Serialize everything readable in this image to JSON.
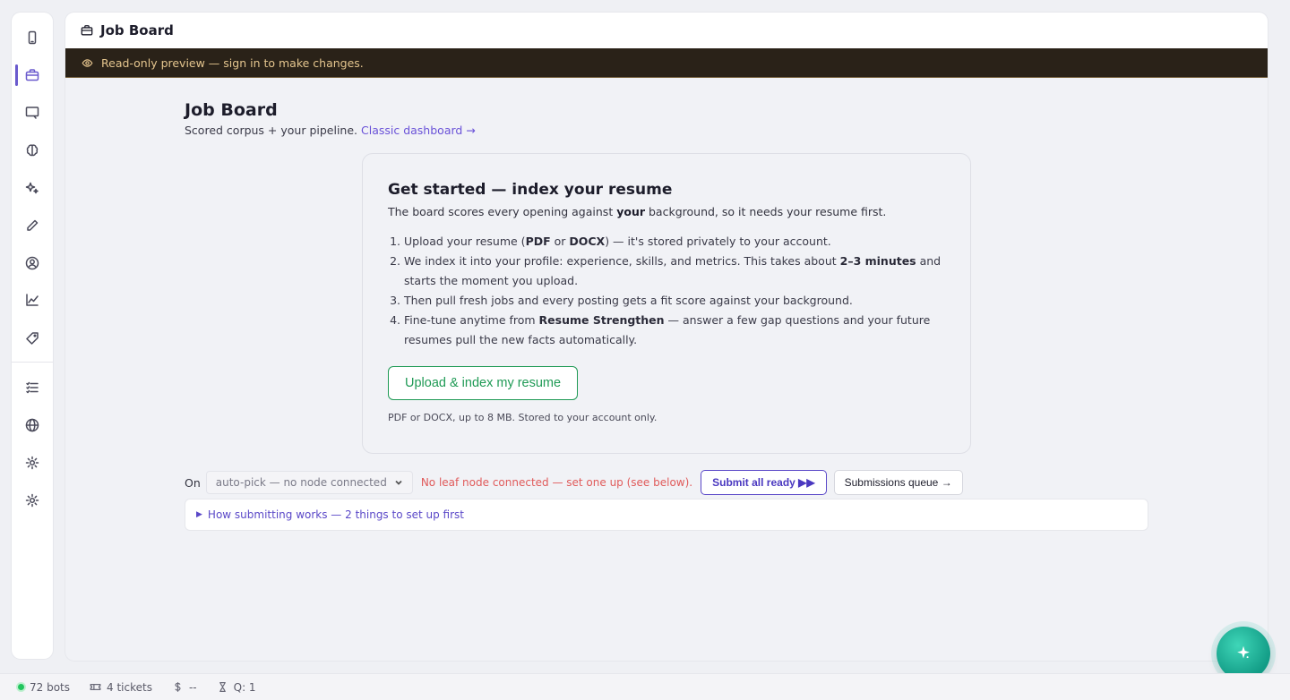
{
  "sidebar": {
    "items": [
      {
        "icon": "phone-icon"
      },
      {
        "icon": "briefcase-icon",
        "active": true
      },
      {
        "icon": "monitor-icon"
      },
      {
        "icon": "brain-icon"
      },
      {
        "icon": "sparkles-icon"
      },
      {
        "icon": "pencil-icon"
      },
      {
        "icon": "user-circle-icon"
      },
      {
        "icon": "chart-line-icon"
      },
      {
        "icon": "tag-icon"
      },
      {
        "icon": "list-icon"
      },
      {
        "icon": "globe-icon"
      },
      {
        "icon": "gear-icon"
      },
      {
        "icon": "gear-icon"
      }
    ]
  },
  "header": {
    "title": "Job Board"
  },
  "banner": {
    "text": "Read-only preview — sign in to make changes."
  },
  "page": {
    "title": "Job Board",
    "subtitle": "Scored corpus + your pipeline.",
    "link": "Classic dashboard →"
  },
  "card": {
    "title": "Get started — index your resume",
    "desc_pre": "The board scores every opening against ",
    "desc_bold": "your",
    "desc_post": " background, so it needs your resume first.",
    "steps": {
      "s1": {
        "a": "Upload your resume (",
        "b1": "PDF",
        "c": " or ",
        "b2": "DOCX",
        "d": ") — it's stored privately to your account."
      },
      "s2": {
        "a": "We index it into your profile: experience, skills, and metrics. This takes about ",
        "b": "2–3 minutes",
        "c": " and starts the moment you upload."
      },
      "s3": {
        "a": "Then pull fresh jobs and every posting gets a fit score against your background."
      },
      "s4": {
        "a": "Fine-tune anytime from ",
        "b": "Resume Strengthen",
        "c": " — answer a few gap questions and your future resumes pull the new facts automatically."
      }
    },
    "upload_label": "Upload & index my resume",
    "hint": "PDF or DOCX, up to 8 MB. Stored to your account only."
  },
  "controls": {
    "on_label": "On",
    "node_select": "auto-pick — no node connected",
    "warning": "No leaf node connected — set one up (see below).",
    "submit_label": "Submit all ready ▶▶",
    "queue_label": "Submissions queue →"
  },
  "details": {
    "label": "How submitting works — 2 things to set up first"
  },
  "status": {
    "bots": "72 bots",
    "tickets": "4 tickets",
    "cost": "--",
    "queue": "Q: 1"
  },
  "colors": {
    "accent": "#6a52d8",
    "success": "#1f9a55",
    "warning": "#e05a5a",
    "banner_bg": "#2a2218",
    "fab": "#1fb89e"
  }
}
